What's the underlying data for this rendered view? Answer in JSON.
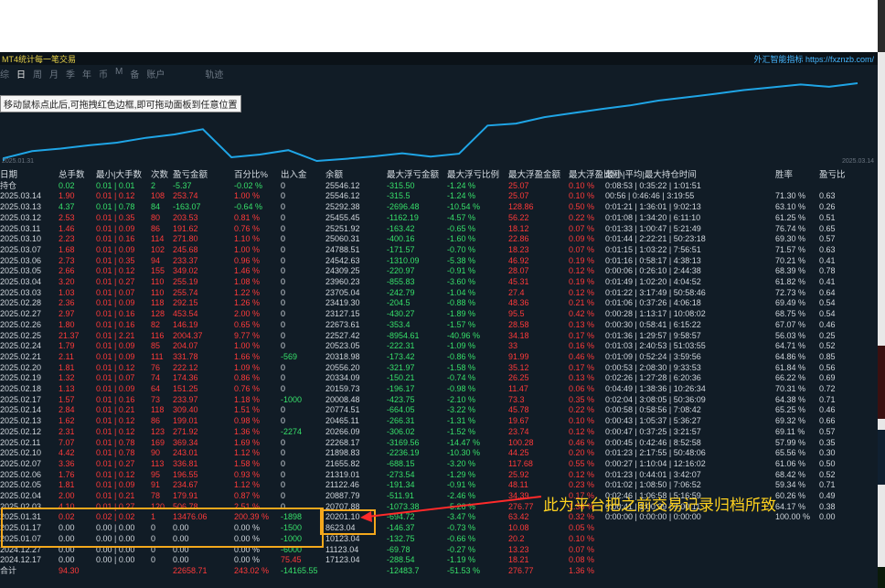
{
  "app": {
    "title": "MT4统计每一笔交易",
    "brand": "外汇智能指标 https://fxznzb.com/"
  },
  "tabs": [
    "综",
    "日",
    "周",
    "月",
    "季",
    "年",
    "币",
    "M",
    "备",
    "账户",
    "轨迹"
  ],
  "active_tab": "日",
  "tooltip": "移动鼠标点此后,可拖拽红色边框,即可拖动面板到任意位置",
  "curve": {
    "start_date": "2025.01.31",
    "end_date": "2025.03.14",
    "color": "#1fa5e6"
  },
  "annotation": "此为平台把之前交易记录归档所致",
  "colors": {
    "positive": "#ff3a3a",
    "negative": "#37e06a",
    "highlight": "#f4a81c",
    "annotation": "#ffd21f"
  },
  "table": {
    "headers": [
      "日期",
      "总手数",
      "最小|大手数",
      "次数",
      "盈亏金额",
      "百分比%",
      "出入金",
      "余额",
      "最大浮亏金额",
      "最大浮亏比例",
      "最大浮盈金额",
      "最大浮盈比例",
      "最小|平均|最大持仓时间",
      "胜率",
      "盈亏比"
    ],
    "rows": [
      [
        "持仓",
        "0.02",
        "0.01 | 0.01",
        "2",
        "-5.37",
        "-0.02 %",
        "0",
        "25546.12",
        "-315.50",
        "-1.24 %",
        "25.07",
        "0.10 %",
        "0:08:53 | 0:35:22 | 1:01:51",
        "",
        ""
      ],
      [
        "2025.03.14",
        "1.90",
        "0.01 | 0.12",
        "108",
        "253.74",
        "1.00 %",
        "0",
        "25546.12",
        "-315.5",
        "-1.24 %",
        "25.07",
        "0.10 %",
        "00:56 | 0:46:46 | 3:19:55",
        "71.30 %",
        "0.63"
      ],
      [
        "2025.03.13",
        "4.37",
        "0.01 | 0.78",
        "84",
        "-163.07",
        "-0.64 %",
        "0",
        "25292.38",
        "-2696.48",
        "-10.54 %",
        "128.86",
        "0.50 %",
        "0:01:21 | 1:36:01 | 9:02:13",
        "63.10 %",
        "0.26"
      ],
      [
        "2025.03.12",
        "2.53",
        "0.01 | 0.35",
        "80",
        "203.53",
        "0.81 %",
        "0",
        "25455.45",
        "-1162.19",
        "-4.57 %",
        "56.22",
        "0.22 %",
        "0:01:08 | 1:34:20 | 6:11:10",
        "61.25 %",
        "0.51"
      ],
      [
        "2025.03.11",
        "1.46",
        "0.01 | 0.09",
        "86",
        "191.62",
        "0.76 %",
        "0",
        "25251.92",
        "-163.42",
        "-0.65 %",
        "18.12",
        "0.07 %",
        "0:01:33 | 1:00:47 | 5:21:49",
        "76.74 %",
        "0.65"
      ],
      [
        "2025.03.10",
        "2.23",
        "0.01 | 0.16",
        "114",
        "271.80",
        "1.10 %",
        "0",
        "25060.31",
        "-400.16",
        "-1.60 %",
        "22.86",
        "0.09 %",
        "0:01:44 | 2:22:21 | 50:23:18",
        "69.30 %",
        "0.57"
      ],
      [
        "2025.03.07",
        "1.68",
        "0.01 | 0.09",
        "102",
        "245.68",
        "1.00 %",
        "0",
        "24788.51",
        "-171.57",
        "-0.70 %",
        "18.23",
        "0.07 %",
        "0:01:15 | 1:03:22 | 7:56:51",
        "71.57 %",
        "0.63"
      ],
      [
        "2025.03.06",
        "2.73",
        "0.01 | 0.35",
        "94",
        "233.37",
        "0.96 %",
        "0",
        "24542.63",
        "-1310.09",
        "-5.38 %",
        "46.92",
        "0.19 %",
        "0:01:16 | 0:58:17 | 4:38:13",
        "70.21 %",
        "0.41"
      ],
      [
        "2025.03.05",
        "2.66",
        "0.01 | 0.12",
        "155",
        "349.02",
        "1.46 %",
        "0",
        "24309.25",
        "-220.97",
        "-0.91 %",
        "28.07",
        "0.12 %",
        "0:00:06 | 0:26:10 | 2:44:38",
        "68.39 %",
        "0.78"
      ],
      [
        "2025.03.04",
        "3.20",
        "0.01 | 0.27",
        "110",
        "255.19",
        "1.08 %",
        "0",
        "23960.23",
        "-855.83",
        "-3.60 %",
        "45.31",
        "0.19 %",
        "0:01:49 | 1:02:20 | 4:04:52",
        "61.82 %",
        "0.41"
      ],
      [
        "2025.03.03",
        "1.03",
        "0.01 | 0.07",
        "110",
        "255.74",
        "1.22 %",
        "0",
        "23705.04",
        "-242.79",
        "-1.04 %",
        "27.4",
        "0.12 %",
        "0:01:22 | 3:17:49 | 50:58:46",
        "72.73 %",
        "0.64"
      ],
      [
        "2025.02.28",
        "2.36",
        "0.01 | 0.09",
        "118",
        "292.15",
        "1.26 %",
        "0",
        "23419.30",
        "-204.5",
        "-0.88 %",
        "48.36",
        "0.21 %",
        "0:01:06 | 0:37:26 | 4:06:18",
        "69.49 %",
        "0.54"
      ],
      [
        "2025.02.27",
        "2.97",
        "0.01 | 0.16",
        "128",
        "453.54",
        "2.00 %",
        "0",
        "23127.15",
        "-430.27",
        "-1.89 %",
        "95.5",
        "0.42 %",
        "0:00:28 | 1:13:17 | 10:08:02",
        "68.75 %",
        "0.54"
      ],
      [
        "2025.02.26",
        "1.80",
        "0.01 | 0.16",
        "82",
        "146.19",
        "0.65 %",
        "0",
        "22673.61",
        "-353.4",
        "-1.57 %",
        "28.58",
        "0.13 %",
        "0:00:30 | 0:58:41 | 6:15:22",
        "67.07 %",
        "0.46"
      ],
      [
        "2025.02.25",
        "21.37",
        "0.01 | 2.21",
        "116",
        "2004.37",
        "9.77 %",
        "0",
        "22527.42",
        "-8954.61",
        "-40.96 %",
        "34.18",
        "0.17 %",
        "0:01:36 | 1:29:57 | 9:58:57",
        "56.03 %",
        "0.25"
      ],
      [
        "2025.02.24",
        "1.79",
        "0.01 | 0.09",
        "85",
        "204.07",
        "1.00 %",
        "0",
        "20523.05",
        "-222.31",
        "-1.09 %",
        "33",
        "0.16 %",
        "0:01:03 | 2:40:53 | 51:03:55",
        "64.71 %",
        "0.52"
      ],
      [
        "2025.02.21",
        "2.11",
        "0.01 | 0.09",
        "111",
        "331.78",
        "1.66 %",
        "-569",
        "20318.98",
        "-173.42",
        "-0.86 %",
        "91.99",
        "0.46 %",
        "0:01:09 | 0:52:24 | 3:59:56",
        "64.86 %",
        "0.85"
      ],
      [
        "2025.02.20",
        "1.81",
        "0.01 | 0.12",
        "76",
        "222.12",
        "1.09 %",
        "0",
        "20556.20",
        "-321.97",
        "-1.58 %",
        "35.12",
        "0.17 %",
        "0:00:53 | 2:08:30 | 9:33:53",
        "61.84 %",
        "0.56"
      ],
      [
        "2025.02.19",
        "1.32",
        "0.01 | 0.07",
        "74",
        "174.36",
        "0.86 %",
        "0",
        "20334.09",
        "-150.21",
        "-0.74 %",
        "26.25",
        "0.13 %",
        "0:02:26 | 1:27:28 | 6:20:36",
        "66.22 %",
        "0.69"
      ],
      [
        "2025.02.18",
        "1.13",
        "0.01 | 0.09",
        "64",
        "151.25",
        "0.76 %",
        "0",
        "20159.73",
        "-196.17",
        "-0.98 %",
        "11.47",
        "0.06 %",
        "0:04:49 | 1:38:36 | 10:26:34",
        "70.31 %",
        "0.72"
      ],
      [
        "2025.02.17",
        "1.57",
        "0.01 | 0.16",
        "73",
        "233.97",
        "1.18 %",
        "-1000",
        "20008.48",
        "-423.75",
        "-2.10 %",
        "73.3",
        "0.35 %",
        "0:02:04 | 3:08:05 | 50:36:09",
        "64.38 %",
        "0.71"
      ],
      [
        "2025.02.14",
        "2.84",
        "0.01 | 0.21",
        "118",
        "309.40",
        "1.51 %",
        "0",
        "20774.51",
        "-664.05",
        "-3.22 %",
        "45.78",
        "0.22 %",
        "0:00:58 | 0:58:56 | 7:08:42",
        "65.25 %",
        "0.46"
      ],
      [
        "2025.02.13",
        "1.62",
        "0.01 | 0.12",
        "86",
        "199.01",
        "0.98 %",
        "0",
        "20465.11",
        "-266.31",
        "-1.31 %",
        "19.67",
        "0.10 %",
        "0:00:43 | 1:05:37 | 5:36:27",
        "69.32 %",
        "0.66"
      ],
      [
        "2025.02.12",
        "2.31",
        "0.01 | 0.12",
        "123",
        "271.92",
        "1.36 %",
        "-2274",
        "20266.09",
        "-306.02",
        "-1.52 %",
        "23.74",
        "0.12 %",
        "0:00:47 | 0:37:25 | 3:21:57",
        "69.11 %",
        "0.57"
      ],
      [
        "2025.02.11",
        "7.07",
        "0.01 | 0.78",
        "169",
        "369.34",
        "1.69 %",
        "0",
        "22268.17",
        "-3169.56",
        "-14.47 %",
        "100.28",
        "0.46 %",
        "0:00:45 | 0:42:46 | 8:52:58",
        "57.99 %",
        "0.35"
      ],
      [
        "2025.02.10",
        "4.42",
        "0.01 | 0.78",
        "90",
        "243.01",
        "1.12 %",
        "0",
        "21898.83",
        "-2236.19",
        "-10.30 %",
        "44.25",
        "0.20 %",
        "0:01:23 | 2:17:55 | 50:48:06",
        "65.56 %",
        "0.30"
      ],
      [
        "2025.02.07",
        "3.36",
        "0.01 | 0.27",
        "113",
        "336.81",
        "1.58 %",
        "0",
        "21655.82",
        "-688.15",
        "-3.20 %",
        "117.68",
        "0.55 %",
        "0:00:27 | 1:10:04 | 12:16:02",
        "61.06 %",
        "0.50"
      ],
      [
        "2025.02.06",
        "1.76",
        "0.01 | 0.12",
        "95",
        "196.55",
        "0.93 %",
        "0",
        "21319.01",
        "-273.54",
        "-1.29 %",
        "25.92",
        "0.12 %",
        "0:01:23 | 0:44:01 | 3:42:07",
        "68.42 %",
        "0.52"
      ],
      [
        "2025.02.05",
        "1.81",
        "0.01 | 0.09",
        "91",
        "234.67",
        "1.12 %",
        "0",
        "21122.46",
        "-191.34",
        "-0.91 %",
        "48.11",
        "0.23 %",
        "0:01:02 | 1:08:50 | 7:06:52",
        "59.34 %",
        "0.71"
      ],
      [
        "2025.02.04",
        "2.00",
        "0.01 | 0.21",
        "78",
        "179.91",
        "0.87 %",
        "0",
        "20887.79",
        "-511.91",
        "-2.46 %",
        "34.39",
        "0.17 %",
        "0:02:46 | 1:06:58 | 5:16:59",
        "60.26 %",
        "0.49"
      ],
      [
        "2025.02.03",
        "4.10",
        "0.01 | 0.27",
        "120",
        "506.78",
        "2.51 %",
        "0",
        "20707.88",
        "-1073.38",
        "-5.26 %",
        "276.77",
        "1.36 %",
        "0:00:41 | 1:00:39 | 7:00:11",
        "64.17 %",
        "0.38"
      ],
      [
        "2025.01.31",
        "0.02",
        "0.02 | 0.02",
        "1",
        "13476.06",
        "200.39 %",
        "-1898",
        "20201.10",
        "-694.72",
        "-3.47 %",
        "63.42",
        "0.32 %",
        "0:00:00 | 0:00:00 | 0:00:00",
        "100.00 %",
        "0.00"
      ],
      [
        "2025.01.17",
        "0.00",
        "0.00 | 0.00",
        "0",
        "0.00",
        "0.00 %",
        "-1500",
        "8623.04",
        "-146.37",
        "-0.73 %",
        "10.08",
        "0.05 %",
        "",
        "",
        ""
      ],
      [
        "2025.01.07",
        "0.00",
        "0.00 | 0.00",
        "0",
        "0.00",
        "0.00 %",
        "-1000",
        "10123.04",
        "-132.75",
        "-0.66 %",
        "20.2",
        "0.10 %",
        "",
        "",
        ""
      ],
      [
        "2024.12.27",
        "0.00",
        "0.00 | 0.00",
        "0",
        "0.00",
        "0.00 %",
        "-6000",
        "11123.04",
        "-69.78",
        "-0.27 %",
        "13.23",
        "0.07 %",
        "",
        "",
        ""
      ],
      [
        "2024.12.17",
        "0.00",
        "0.00 | 0.00",
        "0",
        "0.00",
        "0.00 %",
        "75.45",
        "17123.04",
        "-288.54",
        "-1.19 %",
        "18.21",
        "0.08 %",
        "",
        "",
        ""
      ]
    ],
    "total": [
      "合计",
      "94.30",
      "",
      "",
      "22658.71",
      "243.02 %",
      "-14165.55",
      "",
      "-12483.7",
      "-51.53 %",
      "276.77",
      "1.36 %",
      "",
      "",
      ""
    ]
  }
}
